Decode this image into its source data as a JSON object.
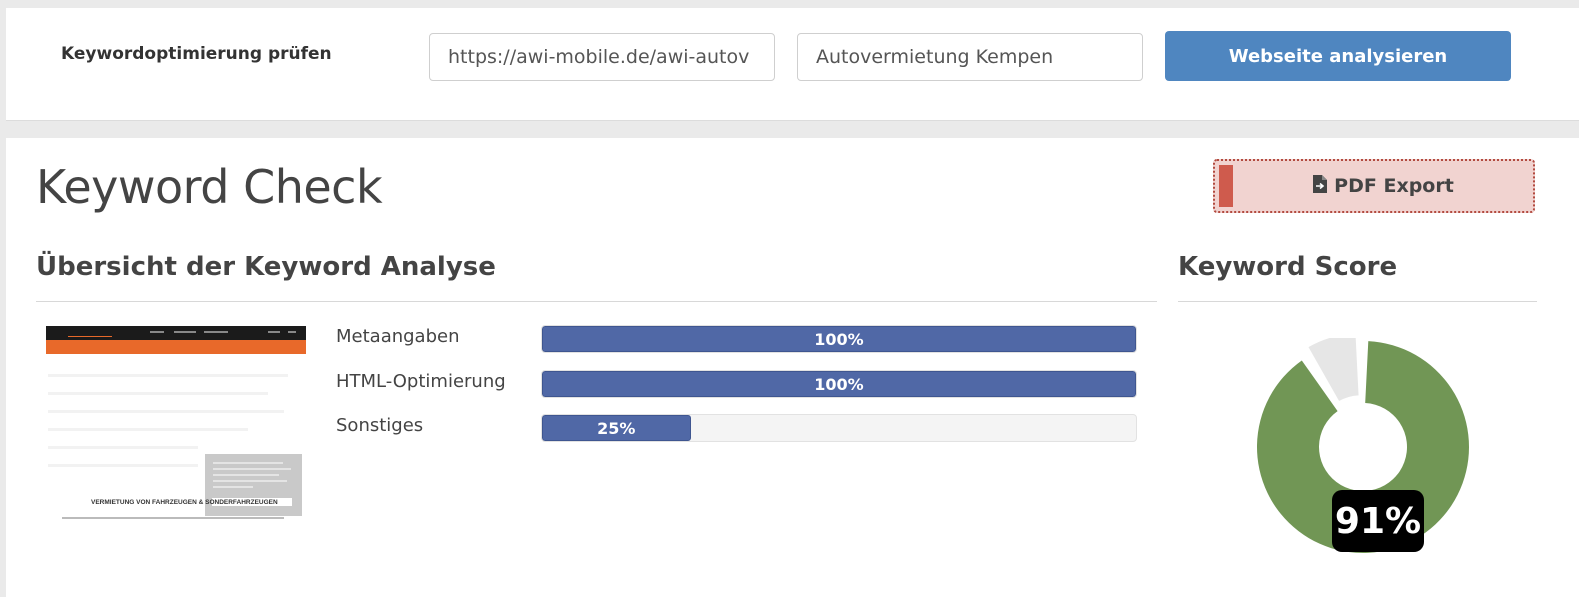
{
  "header": {
    "title": "Keywordoptimierung prüfen",
    "url_value": "https://awi-mobile.de/awi-autov",
    "keyword_value": "Autovermietung Kempen",
    "analyze_label": "Webseite analysieren"
  },
  "main": {
    "page_title": "Keyword Check",
    "pdf_label": "PDF Export",
    "overview_title": "Übersicht der Keyword Analyse",
    "score_title": "Keyword Score",
    "thumbnail_caption": "VERMIETUNG VON FAHRZEUGEN & SONDERFAHRZEUGEN",
    "bars": [
      {
        "label": "Metaangaben",
        "value": 100,
        "text": "100%"
      },
      {
        "label": "HTML-Optimierung",
        "value": 100,
        "text": "100%"
      },
      {
        "label": "Sonstiges",
        "value": 25,
        "text": "25%"
      }
    ],
    "score": {
      "value": 91,
      "text": "91%"
    }
  },
  "colors": {
    "accent_blue": "#4f86c0",
    "bar_fill": "#5068a6",
    "donut_green": "#719655",
    "donut_grey": "#e6e6e6",
    "pdf_bg": "#f1d3d0",
    "pdf_accent": "#cf5b4d"
  },
  "icons": {
    "pdf": "file-export-icon"
  }
}
